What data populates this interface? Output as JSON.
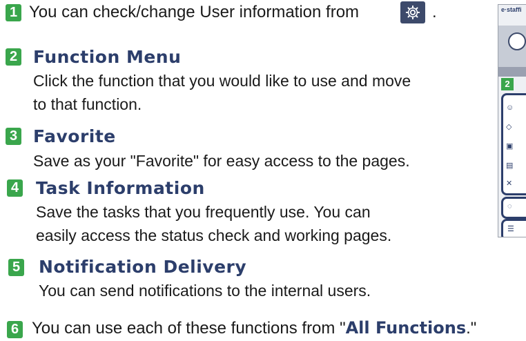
{
  "items": [
    {
      "num": "1",
      "text": "You can check/change User information from",
      "suffix": "."
    },
    {
      "num": "2",
      "heading": "Function Menu",
      "desc1": "Click the function that you would like to use and move",
      "desc2": "to that function."
    },
    {
      "num": "3",
      "heading": "Favorite",
      "desc1": "Save as your \"Favorite\" for easy access to the pages."
    },
    {
      "num": "4",
      "heading": "Task Information",
      "desc1": "Save the tasks that you frequently use. You can",
      "desc2": "easily access the status check and working pages."
    },
    {
      "num": "5",
      "heading": "Notification Delivery",
      "desc1": "You can send notifications to the internal users."
    },
    {
      "num": "6",
      "text": "You can use each of these functions from \"",
      "strong": "All Functions",
      "suffix": ".\""
    }
  ],
  "thumbnail": {
    "title": "e·staffi",
    "badge": "2"
  },
  "colors": {
    "badge": "#3aa64c",
    "heading": "#2c3e6b",
    "gear_bg": "#3d4a6b"
  }
}
